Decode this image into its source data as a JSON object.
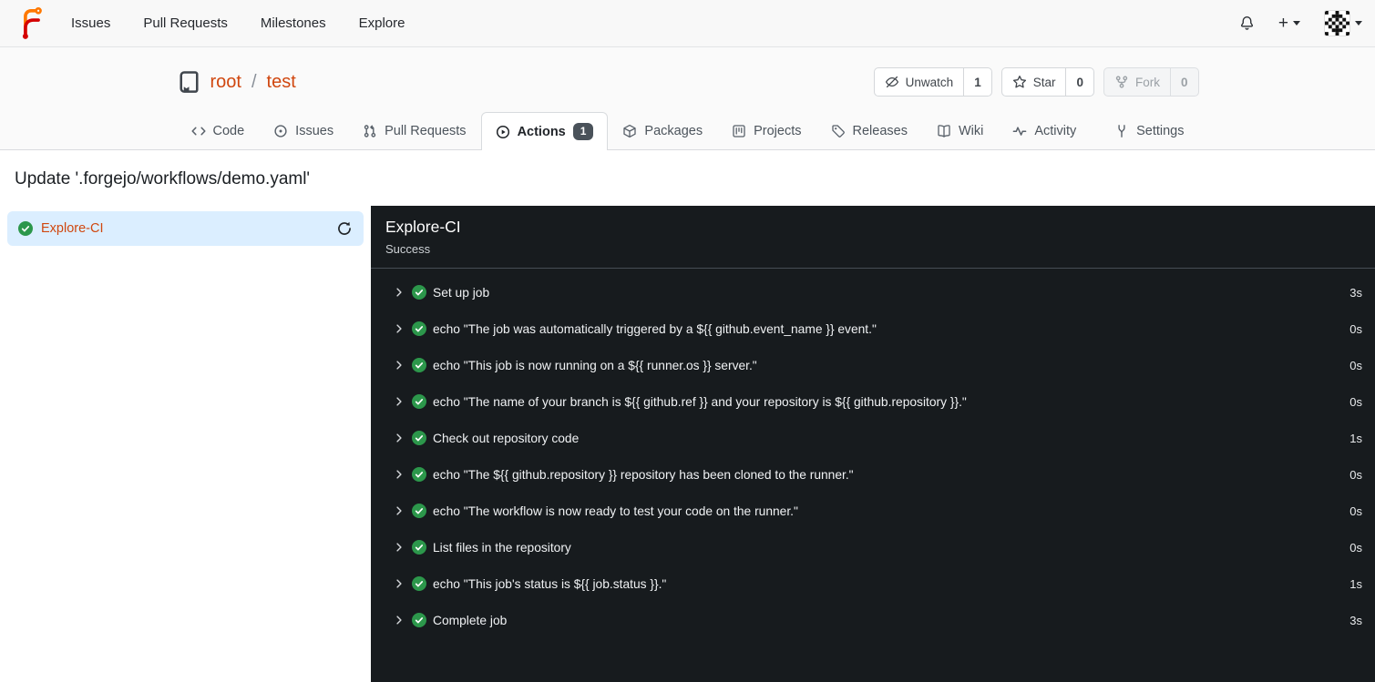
{
  "topnav": {
    "items": [
      "Issues",
      "Pull Requests",
      "Milestones",
      "Explore"
    ],
    "plus": "+"
  },
  "repo_header": {
    "owner": "root",
    "separator": "/",
    "name": "test",
    "actions": [
      {
        "label": "Unwatch",
        "count": "1"
      },
      {
        "label": "Star",
        "count": "0"
      },
      {
        "label": "Fork",
        "count": "0"
      }
    ]
  },
  "tabs": [
    {
      "label": "Code"
    },
    {
      "label": "Issues"
    },
    {
      "label": "Pull Requests"
    },
    {
      "label": "Actions",
      "badge": "1"
    },
    {
      "label": "Packages"
    },
    {
      "label": "Projects"
    },
    {
      "label": "Releases"
    },
    {
      "label": "Wiki"
    },
    {
      "label": "Activity"
    }
  ],
  "settings_tab": {
    "label": "Settings"
  },
  "page": {
    "title": "Update '.forgejo/workflows/demo.yaml'"
  },
  "sidebar": {
    "job": {
      "label": "Explore-CI"
    }
  },
  "panel": {
    "title": "Explore-CI",
    "status": "Success",
    "steps": [
      {
        "label": "Set up job",
        "duration": "3s"
      },
      {
        "label": "echo \"The job was automatically triggered by a ${{ github.event_name }} event.\"",
        "duration": "0s"
      },
      {
        "label": "echo \"This job is now running on a ${{ runner.os }} server.\"",
        "duration": "0s"
      },
      {
        "label": "echo \"The name of your branch is ${{ github.ref }} and your repository is ${{ github.repository }}.\"",
        "duration": "0s"
      },
      {
        "label": "Check out repository code",
        "duration": "1s"
      },
      {
        "label": "echo \"The ${{ github.repository }} repository has been cloned to the runner.\"",
        "duration": "0s"
      },
      {
        "label": "echo \"The workflow is now ready to test your code on the runner.\"",
        "duration": "0s"
      },
      {
        "label": "List files in the repository",
        "duration": "0s"
      },
      {
        "label": "echo \"This job's status is ${{ job.status }}.\"",
        "duration": "1s"
      },
      {
        "label": "Complete job",
        "duration": "3s"
      }
    ]
  },
  "colors": {
    "primary_link": "#d0470f",
    "success_green": "#2c974b",
    "panel_background": "#171b1e",
    "selected_job_background": "#dbeeff",
    "badge_background": "#4a525a"
  }
}
